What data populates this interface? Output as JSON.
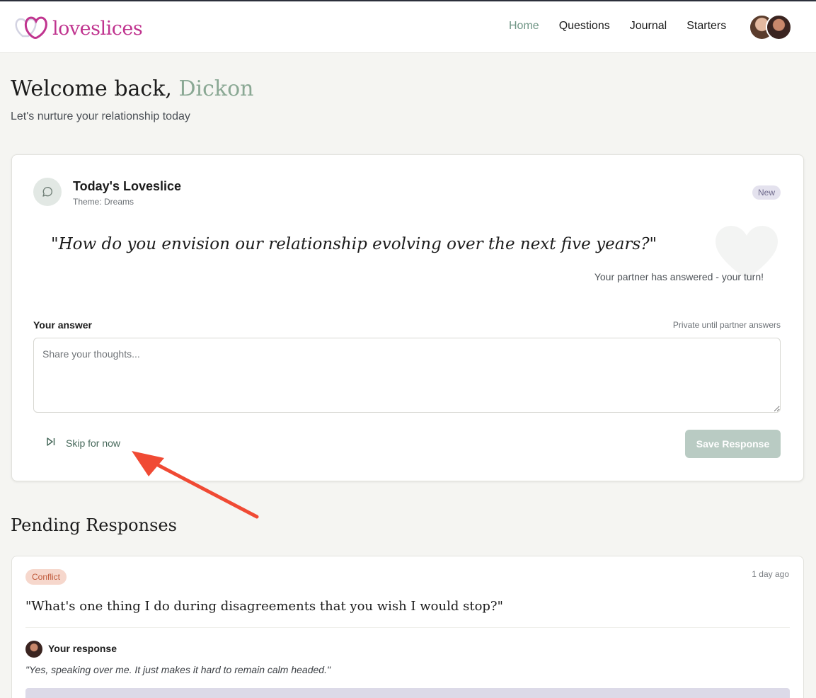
{
  "brand": {
    "name": "loveslices",
    "color": "#c0348f"
  },
  "nav": {
    "links": [
      {
        "label": "Home",
        "active": true
      },
      {
        "label": "Questions",
        "active": false
      },
      {
        "label": "Journal",
        "active": false
      },
      {
        "label": "Starters",
        "active": false
      }
    ],
    "avatar_icons": [
      "partner-avatar",
      "user-avatar"
    ]
  },
  "welcome": {
    "greeting": "Welcome back, ",
    "name": "Dickon",
    "subtitle": "Let's nurture your relationship today"
  },
  "today_card": {
    "icon": "chat-bubble-icon",
    "title": "Today's Loveslice",
    "theme": "Theme: Dreams",
    "badge": "New",
    "question": "\"How do you envision our relationship evolving over the next five years?\"",
    "partner_note": "Your partner has answered - your turn!",
    "answer_label": "Your answer",
    "private_note": "Private until partner answers",
    "answer_placeholder": "Share your thoughts...",
    "answer_value": "",
    "skip_label": "Skip for now",
    "save_label": "Save Response"
  },
  "pending": {
    "title": "Pending Responses",
    "items": [
      {
        "tag": "Conflict",
        "time": "1 day ago",
        "question": "\"What's one thing I do during disagreements that you wish I would stop?\"",
        "response_label": "Your response",
        "response_text": "\"Yes, speaking over me. It just makes it hard to remain calm headed.\""
      }
    ]
  },
  "colors": {
    "accent_green": "#6f9585",
    "tag_conflict_bg": "#f6d7cc",
    "badge_new_bg": "#e4e2ee",
    "annotation_arrow": "#f04a34"
  }
}
